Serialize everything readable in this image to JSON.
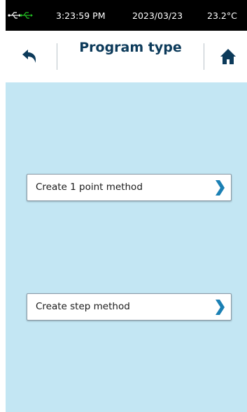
{
  "status_bar": {
    "time": "3:23:59 PM",
    "date": "2023/03/23",
    "temperature": "23.2°C",
    "icons": [
      "usb-icon",
      "usb-connected-icon"
    ]
  },
  "header": {
    "title": "Program type",
    "back_icon": "back-arrow-icon",
    "home_icon": "home-icon"
  },
  "menu": {
    "items": [
      {
        "label": "Create 1 point method",
        "icon": "chevron-right-icon"
      },
      {
        "label": "Create step method",
        "icon": "chevron-right-icon"
      }
    ]
  },
  "colors": {
    "status_bar_bg": "#000000",
    "usb_connected": "#22c022",
    "title": "#0c3a5a",
    "content_bg": "#c3e6f3",
    "chevron": "#1b80b4"
  }
}
